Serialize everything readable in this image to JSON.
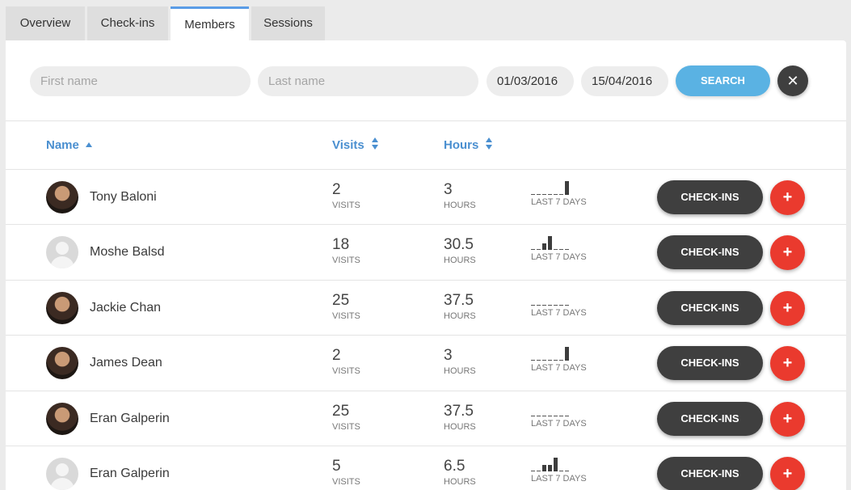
{
  "tabs": [
    {
      "label": "Overview",
      "active": false
    },
    {
      "label": "Check-ins",
      "active": false
    },
    {
      "label": "Members",
      "active": true
    },
    {
      "label": "Sessions",
      "active": false
    }
  ],
  "filters": {
    "first_name_placeholder": "First name",
    "last_name_placeholder": "Last name",
    "date_from": "01/03/2016",
    "date_to": "15/04/2016",
    "search_label": "SEARCH",
    "clear_label": "✕"
  },
  "table": {
    "columns": {
      "name": "Name",
      "visits": "Visits",
      "hours": "Hours"
    },
    "visits_unit": "VISITS",
    "hours_unit": "HOURS",
    "spark_label": "LAST 7 DAYS",
    "checkins_label": "CHECK-INS",
    "add_label": "+",
    "rows": [
      {
        "name": "Tony Baloni",
        "visits": "2",
        "hours": "3",
        "avatar": "photo",
        "last7": [
          0,
          0,
          0,
          0,
          0,
          0,
          1
        ]
      },
      {
        "name": "Moshe Balsd",
        "visits": "18",
        "hours": "30.5",
        "avatar": "placeholder",
        "last7": [
          0,
          0,
          0.45,
          1,
          0,
          0,
          0
        ]
      },
      {
        "name": "Jackie Chan",
        "visits": "25",
        "hours": "37.5",
        "avatar": "photo",
        "last7": [
          0,
          0,
          0,
          0,
          0,
          0,
          0
        ]
      },
      {
        "name": "James Dean",
        "visits": "2",
        "hours": "3",
        "avatar": "photo",
        "last7": [
          0,
          0,
          0,
          0,
          0,
          0,
          1
        ]
      },
      {
        "name": "Eran Galperin",
        "visits": "25",
        "hours": "37.5",
        "avatar": "photo",
        "last7": [
          0,
          0,
          0,
          0,
          0,
          0,
          0
        ]
      },
      {
        "name": "Eran Galperin",
        "visits": "5",
        "hours": "6.5",
        "avatar": "placeholder",
        "last7": [
          0,
          0,
          0.45,
          0.45,
          1,
          0,
          0
        ]
      }
    ]
  },
  "colors": {
    "accent": "#4a8fd0",
    "search": "#5ab2e3",
    "dark_button": "#3f3f3f",
    "add_button": "#ea3a2e"
  }
}
